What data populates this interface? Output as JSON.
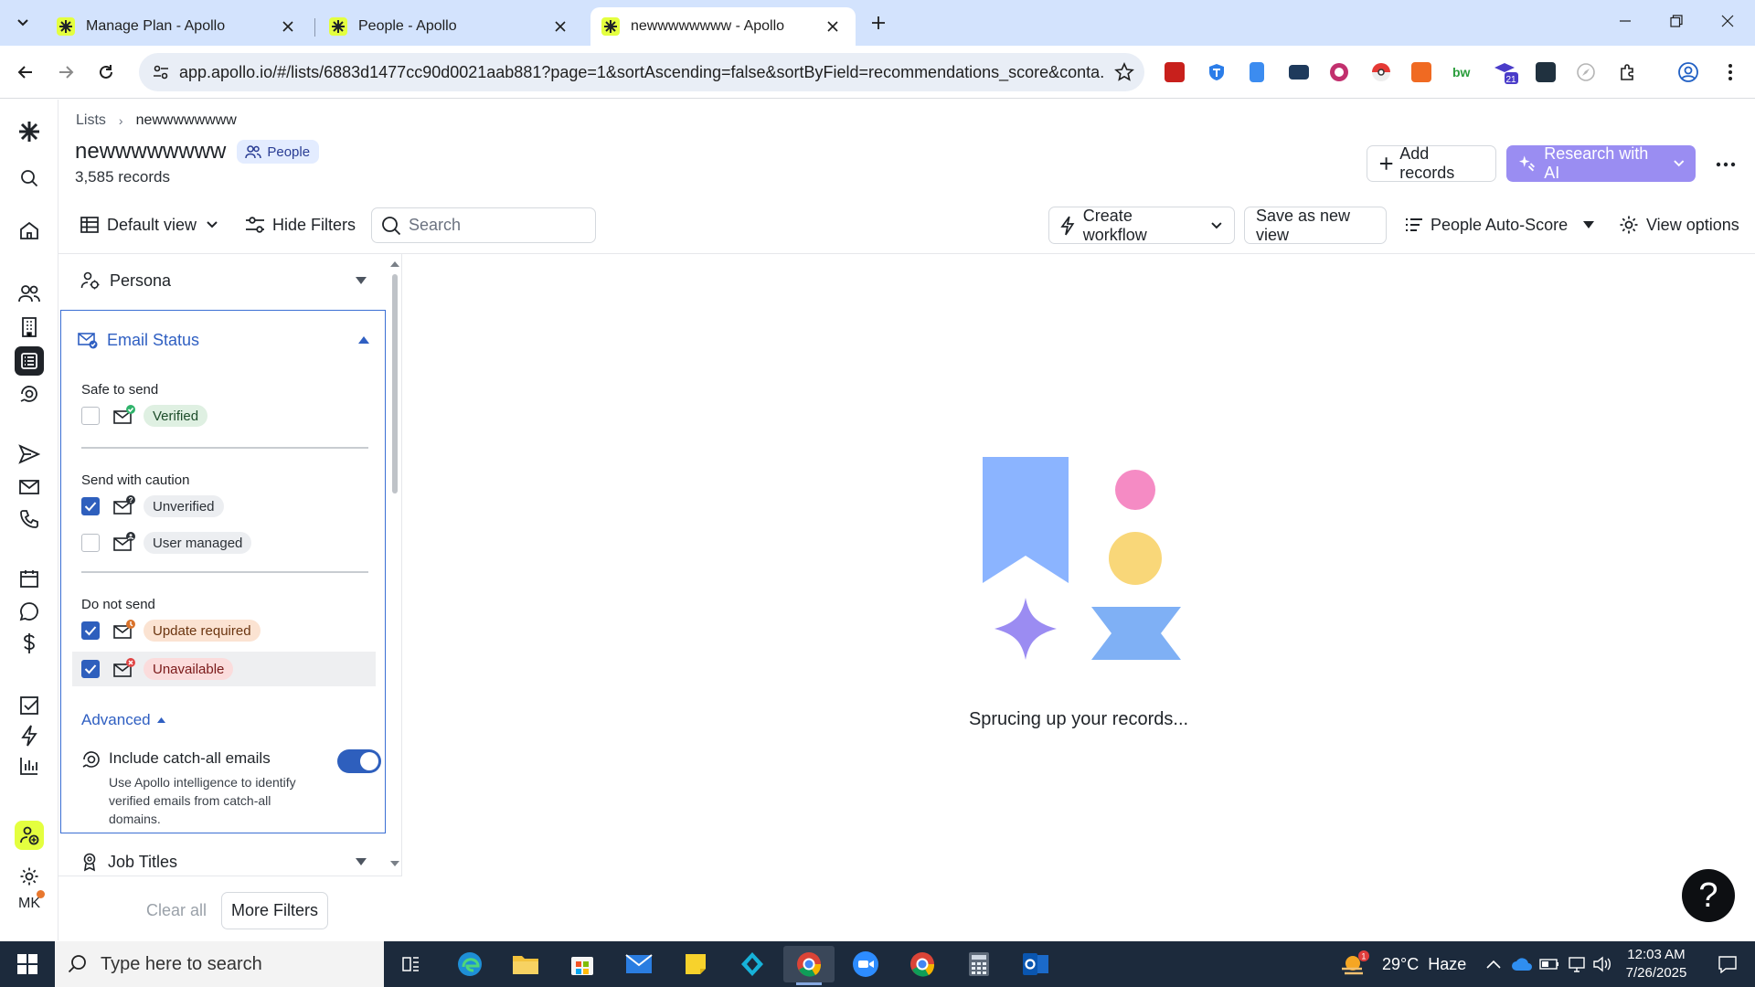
{
  "browser": {
    "tabs": [
      {
        "title": "Manage Plan - Apollo",
        "active": false
      },
      {
        "title": "People - Apollo",
        "active": false
      },
      {
        "title": "newwwwwwww - Apollo",
        "active": true
      }
    ],
    "url": "app.apollo.io/#/lists/6883d1477cc90d0021aab881?page=1&sortAscending=false&sortByField=recommendations_score&conta...",
    "extension_badge": "21"
  },
  "rail": {
    "avatar_initials": "MK"
  },
  "header": {
    "breadcrumb_root": "Lists",
    "breadcrumb_current": "newwwwwwww",
    "title": "newwwwwwww",
    "type_badge": "People",
    "record_count": "3,585 records",
    "add_records": "Add records",
    "research_ai": "Research with AI"
  },
  "controls": {
    "view": "Default view",
    "hide_filters": "Hide Filters",
    "search_placeholder": "Search",
    "create_workflow": "Create workflow",
    "save_view": "Save as new view",
    "sort": "People Auto-Score",
    "view_options": "View options"
  },
  "filters": {
    "persona": "Persona",
    "email_status": {
      "title": "Email Status",
      "groups": [
        {
          "label": "Safe to send",
          "options": [
            {
              "label": "Verified",
              "checked": false,
              "tone": "green",
              "badge_color": "#2fb36b"
            }
          ]
        },
        {
          "label": "Send with caution",
          "options": [
            {
              "label": "Unverified",
              "checked": true,
              "tone": "gray",
              "badge_color": "#2c3137"
            },
            {
              "label": "User managed",
              "checked": false,
              "tone": "gray",
              "badge_color": "#2c3137"
            }
          ]
        },
        {
          "label": "Do not send",
          "options": [
            {
              "label": "Update required",
              "checked": true,
              "tone": "orange",
              "badge_color": "#d9722b"
            },
            {
              "label": "Unavailable",
              "checked": true,
              "tone": "red",
              "badge_color": "#e04444"
            }
          ]
        }
      ],
      "advanced": "Advanced",
      "catch_all_title": "Include catch-all emails",
      "catch_all_desc": "Use Apollo intelligence to identify verified emails from catch-all domains.",
      "catch_all_enabled": true
    },
    "job_titles": "Job Titles",
    "clear_all": "Clear all",
    "more_filters": "More Filters"
  },
  "empty_state": {
    "message": "Sprucing up your records...",
    "colors": {
      "bookmark": "#8bb4ff",
      "pink": "#f58bc4",
      "yellow": "#f9d779",
      "star": "#9b8cf2",
      "bowtie": "#7fb0f5"
    }
  },
  "help_label": "?",
  "taskbar": {
    "search_placeholder": "Type here to search",
    "weather_temp": "29°C",
    "weather_cond": "Haze",
    "weather_badge": "1",
    "time": "12:03 AM",
    "date": "7/26/2025"
  }
}
